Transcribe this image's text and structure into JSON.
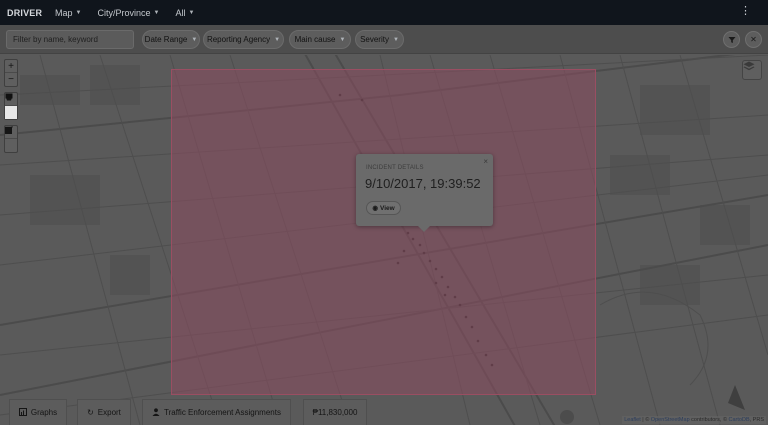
{
  "topbar": {
    "brand": "DRIVER",
    "nav": [
      {
        "label": "Map"
      },
      {
        "label": "City/Province"
      },
      {
        "label": "All"
      }
    ],
    "menu_icon": "kebab-menu-icon"
  },
  "filters": {
    "search_placeholder": "Filter by name, keyword",
    "buttons": [
      {
        "label": "Date Range"
      },
      {
        "label": "Reporting Agency"
      },
      {
        "label": "Main cause"
      },
      {
        "label": "Severity"
      }
    ],
    "filter_icon": "filter-icon",
    "clear_icon": "close-icon"
  },
  "map_controls": {
    "zoom_in": "+",
    "zoom_out": "−",
    "tools": [
      "polygon-icon",
      "rectangle-icon",
      "edit-icon",
      "trash-icon"
    ]
  },
  "popup": {
    "heading": "INCIDENT DETAILS",
    "close": "×",
    "time": "9/10/2017, 19:39:52",
    "view_label": "View"
  },
  "bottom": {
    "graphs_label": "Graphs",
    "export_label": "Export",
    "tea_label": "Traffic Enforcement Assignments",
    "cost_label": "₱11,830,000"
  },
  "attribution": {
    "leaflet": "Leaflet",
    "sep1": " | © ",
    "osm": "OpenStreetMap",
    "mid": " contributors, © ",
    "carto": "CartoDB",
    "tail": ", PRS"
  },
  "colors": {
    "topbar_bg": "#10151c",
    "selection_fill": "#8c4c60",
    "selection_border": "#9a4e62"
  }
}
